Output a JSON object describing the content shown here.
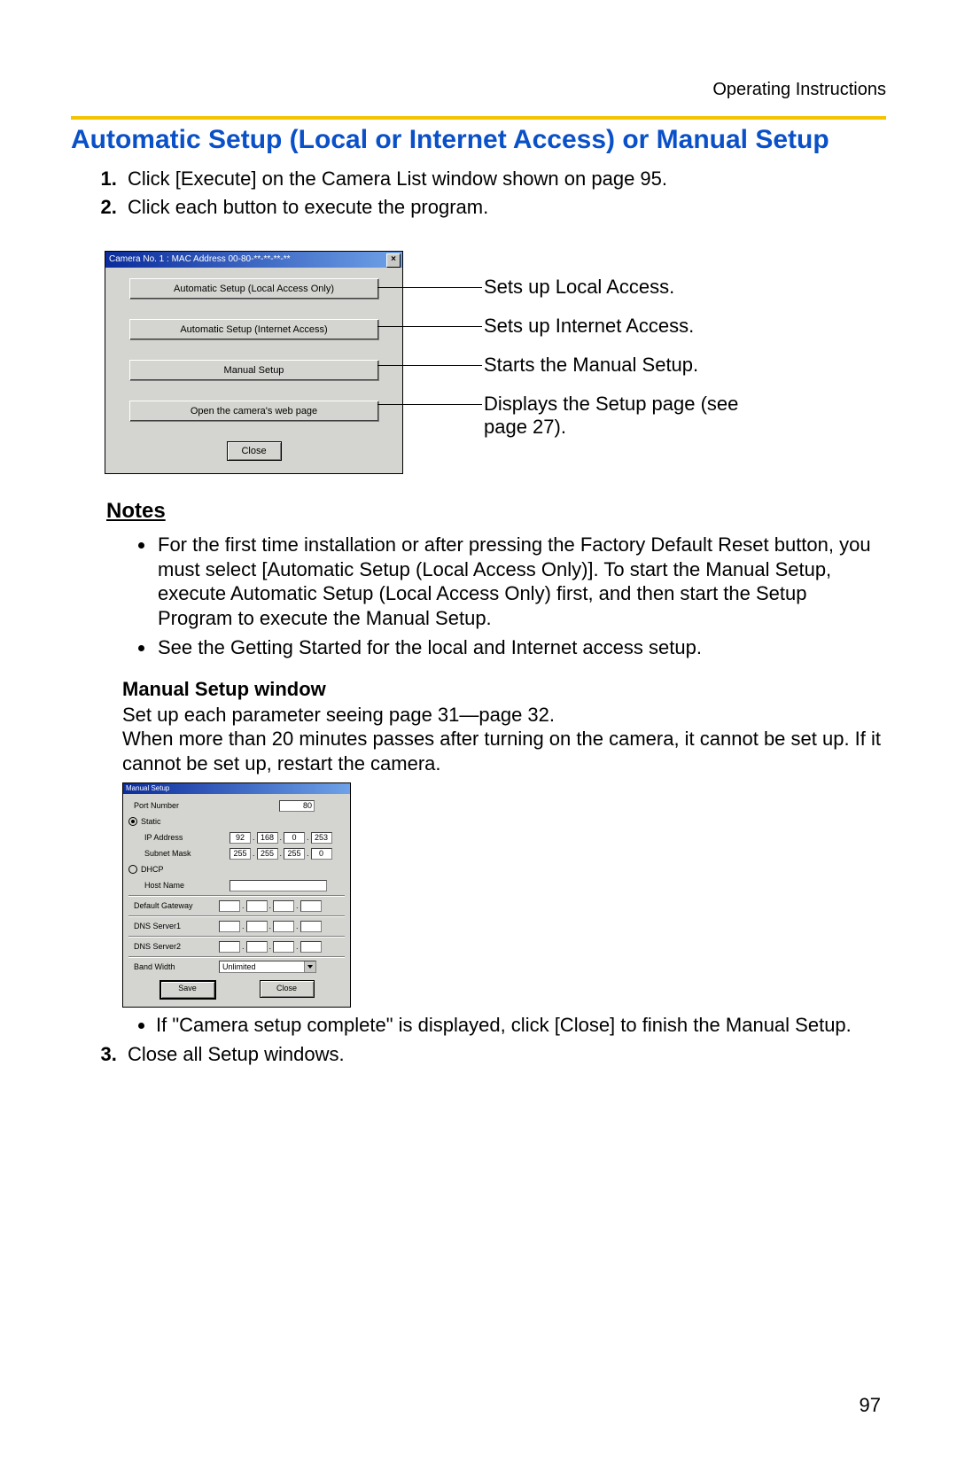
{
  "header": {
    "right": "Operating Instructions"
  },
  "title": "Automatic Setup (Local or Internet Access) or Manual Setup",
  "steps": {
    "s1": "Click [Execute] on the Camera List window shown on page 95.",
    "s2": "Click each button to execute the program.",
    "s3": "Close all Setup windows."
  },
  "dialog1": {
    "title": "Camera No. 1   :   MAC Address   00-80-**-**-**-**",
    "btn1": "Automatic Setup (Local Access Only)",
    "btn2": "Automatic Setup (Internet Access)",
    "btn3": "Manual Setup",
    "btn4": "Open the camera's web page",
    "close": "Close",
    "close_x": "×"
  },
  "callouts": {
    "c1": "Sets up Local Access.",
    "c2": "Sets up Internet Access.",
    "c3": "Starts the Manual Setup.",
    "c4a": "Displays the Setup page (see",
    "c4b": "page 27)."
  },
  "notes_h": "Notes",
  "notes": {
    "n1": "For the first time installation or after pressing the Factory Default Reset button, you must select [Automatic Setup (Local Access Only)]. To start the Manual Setup, execute Automatic Setup (Local Access Only) first, and then start the Setup Program to execute the Manual Setup.",
    "n2": "See the Getting Started for the local and Internet access setup."
  },
  "manual": {
    "heading": "Manual Setup window",
    "p1": "Set up each parameter seeing page 31—page 32.",
    "p2": "When more than 20 minutes passes after turning on the camera, it cannot be set up. If it cannot be set up, restart the camera."
  },
  "dialog2": {
    "title": "Manual Setup",
    "port_label": "Port Number",
    "port_value": "80",
    "static_label": "Static",
    "ip_label": "IP Address",
    "ip": [
      "92",
      "168",
      "0",
      "253"
    ],
    "mask_label": "Subnet Mask",
    "mask": [
      "255",
      "255",
      "255",
      "0"
    ],
    "dhcp_label": "DHCP",
    "host_label": "Host Name",
    "gw_label": "Default Gateway",
    "dns1_label": "DNS Server1",
    "dns2_label": "DNS Server2",
    "bw_label": "Band Width",
    "bw_value": "Unlimited",
    "save": "Save",
    "close": "Close",
    "dot": "."
  },
  "after_note": "If \"Camera setup complete\" is displayed, click [Close] to finish the Manual Setup.",
  "page_number": "97"
}
